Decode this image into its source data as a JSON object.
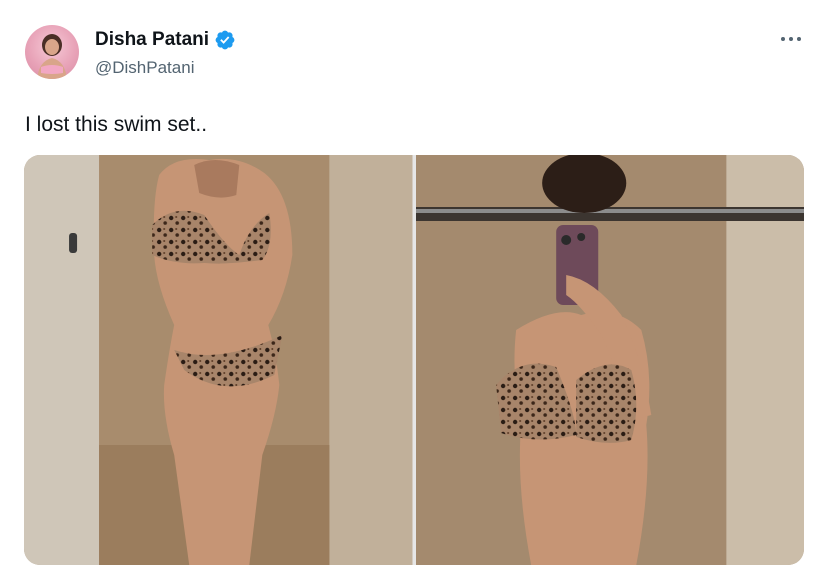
{
  "tweet": {
    "author": {
      "display_name": "Disha Patani",
      "handle": "@DishPatani",
      "verified": true
    },
    "text": "I lost this swim set..",
    "more_icon": "more-horizontal-icon",
    "media": [
      {
        "type": "photo"
      },
      {
        "type": "photo"
      }
    ]
  },
  "colors": {
    "verified_blue": "#1d9bf0",
    "text": "#0f1419",
    "secondary_text": "#536471"
  }
}
